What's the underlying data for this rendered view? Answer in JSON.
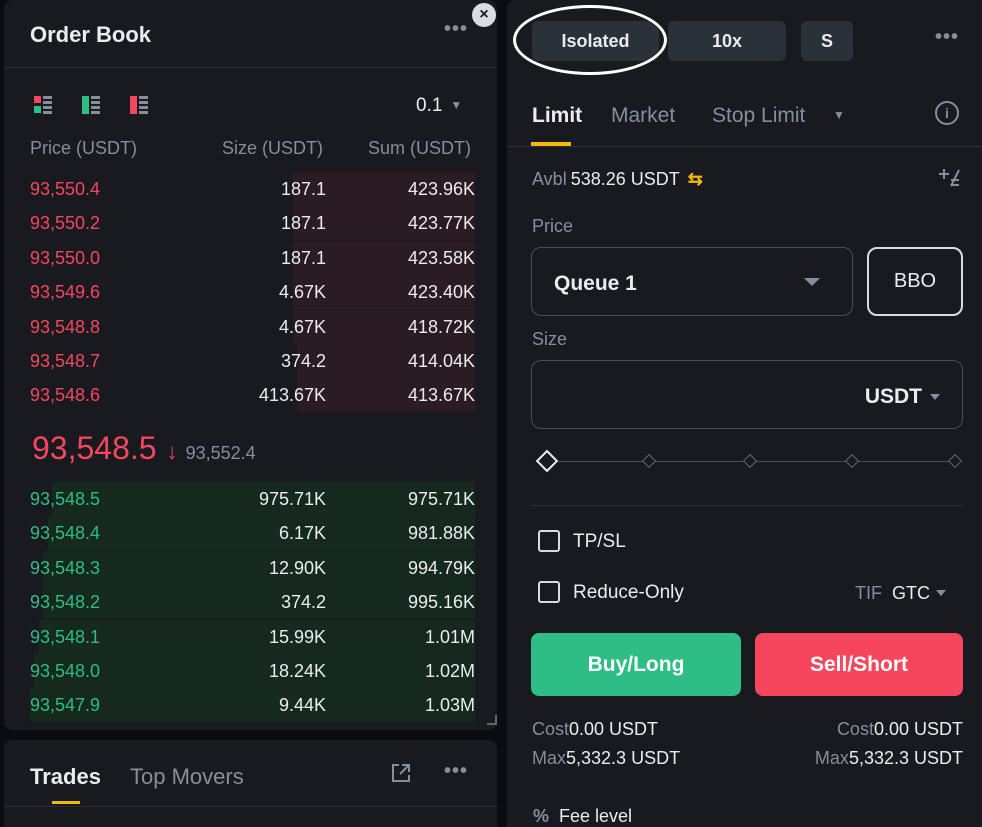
{
  "order_book": {
    "title": "Order Book",
    "precision": "0.1",
    "headers": {
      "price": "Price (USDT)",
      "size": "Size (USDT)",
      "sum": "Sum (USDT)"
    },
    "asks": [
      {
        "price": "93,550.4",
        "size": "187.1",
        "sum": "423.96K",
        "depth": 0.41
      },
      {
        "price": "93,550.2",
        "size": "187.1",
        "sum": "423.77K",
        "depth": 0.41
      },
      {
        "price": "93,550.0",
        "size": "187.1",
        "sum": "423.58K",
        "depth": 0.41
      },
      {
        "price": "93,549.6",
        "size": "4.67K",
        "sum": "423.40K",
        "depth": 0.41
      },
      {
        "price": "93,548.8",
        "size": "4.67K",
        "sum": "418.72K",
        "depth": 0.41
      },
      {
        "price": "93,548.7",
        "size": "374.2",
        "sum": "414.04K",
        "depth": 0.4
      },
      {
        "price": "93,548.6",
        "size": "413.67K",
        "sum": "413.67K",
        "depth": 0.4
      }
    ],
    "mid": {
      "price": "93,548.5",
      "arrow": "↓",
      "mark_price": "93,552.4"
    },
    "bids": [
      {
        "price": "93,548.5",
        "size": "975.71K",
        "sum": "975.71K",
        "depth": 0.95
      },
      {
        "price": "93,548.4",
        "size": "6.17K",
        "sum": "981.88K",
        "depth": 0.96
      },
      {
        "price": "93,548.3",
        "size": "12.90K",
        "sum": "994.79K",
        "depth": 0.97
      },
      {
        "price": "93,548.2",
        "size": "374.2",
        "sum": "995.16K",
        "depth": 0.97
      },
      {
        "price": "93,548.1",
        "size": "15.99K",
        "sum": "1.01M",
        "depth": 0.98
      },
      {
        "price": "93,548.0",
        "size": "18.24K",
        "sum": "1.02M",
        "depth": 0.99
      },
      {
        "price": "93,547.9",
        "size": "9.44K",
        "sum": "1.03M",
        "depth": 1.0
      }
    ]
  },
  "trades_panel": {
    "tabs": [
      "Trades",
      "Top Movers"
    ]
  },
  "trade_form": {
    "margin_mode": "Isolated",
    "leverage": "10x",
    "asset_mode": "S",
    "order_tabs": [
      "Limit",
      "Market",
      "Stop Limit"
    ],
    "avbl_label": "Avbl",
    "avbl_value": "538.26 USDT",
    "price_label": "Price",
    "price_value": "Queue 1",
    "bbo_label": "BBO",
    "size_label": "Size",
    "size_unit": "USDT",
    "slider_level": 0,
    "tpsl_label": "TP/SL",
    "reduce_only_label": "Reduce-Only",
    "tif_label": "TIF",
    "tif_value": "GTC",
    "buy_label": "Buy/Long",
    "sell_label": "Sell/Short",
    "buy": {
      "cost_label": "Cost",
      "cost": "0.00 USDT",
      "max_label": "Max",
      "max": "5,332.3 USDT"
    },
    "sell": {
      "cost_label": "Cost",
      "cost": "0.00 USDT",
      "max_label": "Max",
      "max": "5,332.3 USDT"
    },
    "fee_icon": "%",
    "fee_label": "Fee level"
  },
  "colors": {
    "ask": "#f6465d",
    "bid": "#2ebd85",
    "accent": "#f0b90b",
    "panel": "#181a20"
  }
}
